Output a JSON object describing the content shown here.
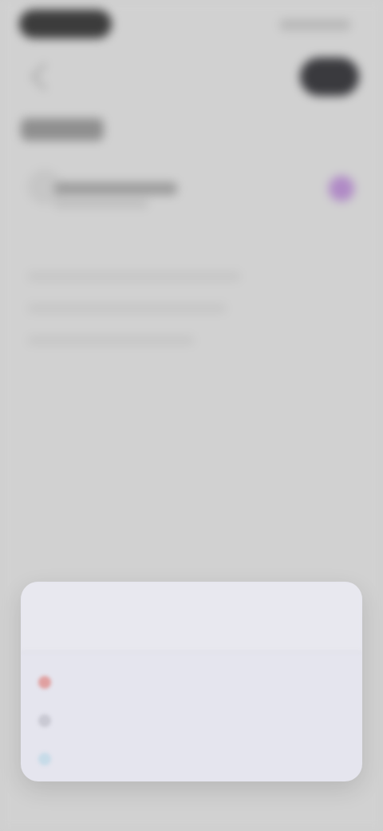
{
  "sheet": {
    "title": "",
    "action_label": "",
    "items": [
      {
        "label": ""
      },
      {
        "label": ""
      },
      {
        "label": ""
      }
    ]
  },
  "colors": {
    "background": "#d1d1d1",
    "accent_radio": "#b08ac6",
    "sheet_background": "#e5e5ee",
    "item_icon_0": "#e0a0a0",
    "item_icon_1": "#c9c9d3",
    "item_icon_2": "#c7dbe8"
  }
}
